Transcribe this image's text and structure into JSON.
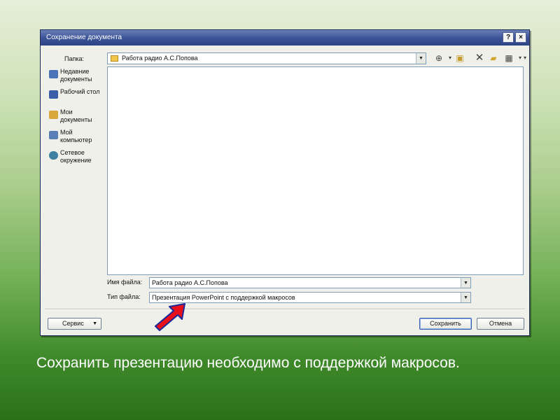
{
  "dialog": {
    "title": "Сохранение документа",
    "title_buttons": [
      "?",
      "×"
    ],
    "folder_label": "Папка:",
    "folder_value": "Работа радио А.С.Попова",
    "places": [
      {
        "label": "Недавние документы",
        "icon": "recent-documents-icon",
        "color": "#4a73b8"
      },
      {
        "label": "Рабочий стол",
        "icon": "desktop-icon",
        "color": "#3a5fa8"
      },
      {
        "label": "Мои документы",
        "icon": "my-documents-icon",
        "color": "#d9a83a"
      },
      {
        "label": "Мой компьютер",
        "icon": "my-computer-icon",
        "color": "#5a7fb8"
      },
      {
        "label": "Сетевое окружение",
        "icon": "network-icon",
        "color": "#3f7fa0"
      }
    ],
    "filename_label": "Имя файла:",
    "filename_value": "Работа радио А.С.Попова",
    "filetype_label": "Тип файла:",
    "filetype_value": "Презентация PowerPoint с поддержкой макросов",
    "service_button": "Сервис",
    "save_button": "Сохранить",
    "cancel_button": "Отмена"
  },
  "caption": "Сохранить презентацию необходимо с поддержкой макросов.",
  "colors": {
    "titlebar": "#3c5598",
    "arrow_fill": "#e8101a",
    "arrow_outline": "#1a2a9a"
  }
}
